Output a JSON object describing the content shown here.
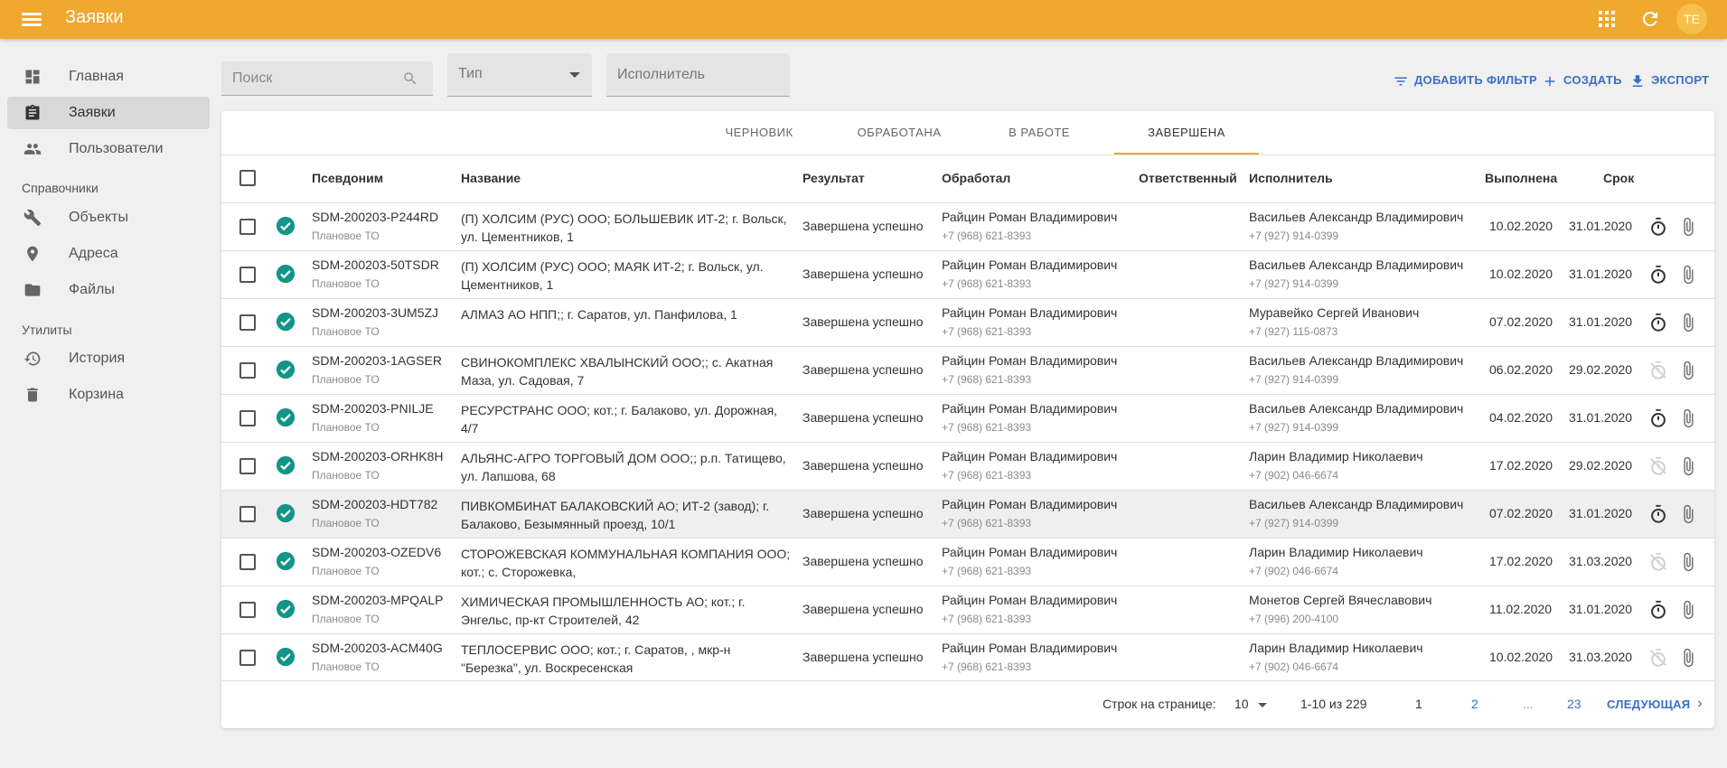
{
  "app": {
    "title": "Заявки",
    "avatar_initials": "TE",
    "accent_color": "#f0a82e",
    "link_color": "#3a6fc4",
    "success_color": "#139488"
  },
  "topbar": {
    "icons": [
      "menu-icon",
      "apps-grid-icon",
      "refresh-icon"
    ]
  },
  "sidebar": {
    "items": [
      {
        "label": "Главная",
        "icon": "dashboard-icon"
      },
      {
        "label": "Заявки",
        "icon": "clipboard-icon",
        "active": true
      },
      {
        "label": "Пользователи",
        "icon": "people-icon"
      }
    ],
    "section_ref": "Справочники",
    "ref_items": [
      {
        "label": "Объекты",
        "icon": "wrench-icon"
      },
      {
        "label": "Адреса",
        "icon": "location-pin-icon"
      },
      {
        "label": "Файлы",
        "icon": "folder-icon"
      }
    ],
    "section_util": "Утилиты",
    "util_items": [
      {
        "label": "История",
        "icon": "history-icon"
      },
      {
        "label": "Корзина",
        "icon": "trash-icon"
      }
    ]
  },
  "filters": {
    "search_placeholder": "Поиск",
    "type_label": "Тип",
    "executor_placeholder": "Исполнитель"
  },
  "actions": {
    "add_filter": "ДОБАВИТЬ ФИЛЬТР",
    "create": "СОЗДАТЬ",
    "export": "ЭКСПОРТ"
  },
  "tabs": [
    "ЧЕРНОВИК",
    "ОБРАБОТАНА",
    "В РАБОТЕ",
    "ЗАВЕРШЕНА"
  ],
  "active_tab": "ЗАВЕРШЕНА",
  "columns": {
    "alias": "Псевдоним",
    "name": "Название",
    "result": "Результат",
    "processed": "Обработал",
    "responsible": "Ответственный",
    "executor": "Исполнитель",
    "done": "Выполнена",
    "due": "Срок"
  },
  "rows": [
    {
      "alias": "SDM-200203-P244RD",
      "sub": "Плановое ТО",
      "name": "(П) ХОЛСИМ (РУС) ООО; БОЛЬШЕВИК ИТ-2; г. Вольск, ул. Цементников, 1",
      "result": "Завершена успешно",
      "processed": "Райцин Роман Владимирович",
      "processed_phone": "+7 (968) 621-8393",
      "executor": "Васильев Александр Владимирович",
      "executor_phone": "+7 (927) 914-0399",
      "done": "10.02.2020",
      "due": "31.01.2020",
      "timer_active": true
    },
    {
      "alias": "SDM-200203-50TSDR",
      "sub": "Плановое ТО",
      "name": "(П) ХОЛСИМ (РУС) ООО; МАЯК ИТ-2; г. Вольск, ул. Цементников, 1",
      "result": "Завершена успешно",
      "processed": "Райцин Роман Владимирович",
      "processed_phone": "+7 (968) 621-8393",
      "executor": "Васильев Александр Владимирович",
      "executor_phone": "+7 (927) 914-0399",
      "done": "10.02.2020",
      "due": "31.01.2020",
      "timer_active": true
    },
    {
      "alias": "SDM-200203-3UM5ZJ",
      "sub": "Плановое ТО",
      "name": "АЛМАЗ АО НПП;; г. Саратов, ул. Панфилова, 1",
      "result": "Завершена успешно",
      "processed": "Райцин Роман Владимирович",
      "processed_phone": "+7 (968) 621-8393",
      "executor": "Муравейко Сергей Иванович",
      "executor_phone": "+7 (927) 115-0873",
      "done": "07.02.2020",
      "due": "31.01.2020",
      "timer_active": true
    },
    {
      "alias": "SDM-200203-1AGSER",
      "sub": "Плановое ТО",
      "name": "СВИНОКОМПЛЕКС ХВАЛЫНСКИЙ ООО;; с. Акатная Маза, ул. Садовая, 7",
      "result": "Завершена успешно",
      "processed": "Райцин Роман Владимирович",
      "processed_phone": "+7 (968) 621-8393",
      "executor": "Васильев Александр Владимирович",
      "executor_phone": "+7 (927) 914-0399",
      "done": "06.02.2020",
      "due": "29.02.2020",
      "timer_active": false
    },
    {
      "alias": "SDM-200203-PNILJE",
      "sub": "Плановое ТО",
      "name": "РЕСУРСТРАНС ООО; кот.; г. Балаково, ул. Дорожная, 4/7",
      "result": "Завершена успешно",
      "processed": "Райцин Роман Владимирович",
      "processed_phone": "+7 (968) 621-8393",
      "executor": "Васильев Александр Владимирович",
      "executor_phone": "+7 (927) 914-0399",
      "done": "04.02.2020",
      "due": "31.01.2020",
      "timer_active": true
    },
    {
      "alias": "SDM-200203-ORHK8H",
      "sub": "Плановое ТО",
      "name": "АЛЬЯНС-АГРО ТОРГОВЫЙ ДОМ ООО;; р.п. Татищево, ул. Лапшова, 68",
      "result": "Завершена успешно",
      "processed": "Райцин Роман Владимирович",
      "processed_phone": "+7 (968) 621-8393",
      "executor": "Ларин Владимир Николаевич",
      "executor_phone": "+7 (902) 046-6674",
      "done": "17.02.2020",
      "due": "29.02.2020",
      "timer_active": false
    },
    {
      "alias": "SDM-200203-HDT782",
      "sub": "Плановое ТО",
      "name": "ПИВКОМБИНАТ БАЛАКОВСКИЙ АО; ИТ-2 (завод); г. Балаково, Безымянный проезд, 10/1",
      "result": "Завершена успешно",
      "processed": "Райцин Роман Владимирович",
      "processed_phone": "+7 (968) 621-8393",
      "executor": "Васильев Александр Владимирович",
      "executor_phone": "+7 (927) 914-0399",
      "done": "07.02.2020",
      "due": "31.01.2020",
      "timer_active": true,
      "highlighted": true
    },
    {
      "alias": "SDM-200203-OZEDV6",
      "sub": "Плановое ТО",
      "name": "СТОРОЖЕВСКАЯ КОММУНАЛЬНАЯ КОМПАНИЯ ООО; кот.; с. Сторожевка,",
      "result": "Завершена успешно",
      "processed": "Райцин Роман Владимирович",
      "processed_phone": "+7 (968) 621-8393",
      "executor": "Ларин Владимир Николаевич",
      "executor_phone": "+7 (902) 046-6674",
      "done": "17.02.2020",
      "due": "31.03.2020",
      "timer_active": false
    },
    {
      "alias": "SDM-200203-MPQALP",
      "sub": "Плановое ТО",
      "name": "ХИМИЧЕСКАЯ ПРОМЫШЛЕННОСТЬ АО; кот.; г. Энгельс, пр-кт Строителей, 42",
      "result": "Завершена успешно",
      "processed": "Райцин Роман Владимирович",
      "processed_phone": "+7 (968) 621-8393",
      "executor": "Монетов Сергей Вячеславович",
      "executor_phone": "+7 (996) 200-4100",
      "done": "11.02.2020",
      "due": "31.01.2020",
      "timer_active": true
    },
    {
      "alias": "SDM-200203-ACM40G",
      "sub": "Плановое ТО",
      "name": "ТЕПЛОСЕРВИС ООО; кот.; г. Саратов, , мкр-н \"Березка\", ул. Воскресенская",
      "result": "Завершена успешно",
      "processed": "Райцин Роман Владимирович",
      "processed_phone": "+7 (968) 621-8393",
      "executor": "Ларин Владимир Николаевич",
      "executor_phone": "+7 (902) 046-6674",
      "done": "10.02.2020",
      "due": "31.03.2020",
      "timer_active": false
    }
  ],
  "footer": {
    "rows_per_page_label": "Строк на странице:",
    "rows_per_page": "10",
    "range": "1-10 из 229",
    "pages": [
      "1",
      "2",
      "...",
      "23"
    ],
    "current_page": "1",
    "next_label": "СЛЕДУЮЩАЯ"
  }
}
